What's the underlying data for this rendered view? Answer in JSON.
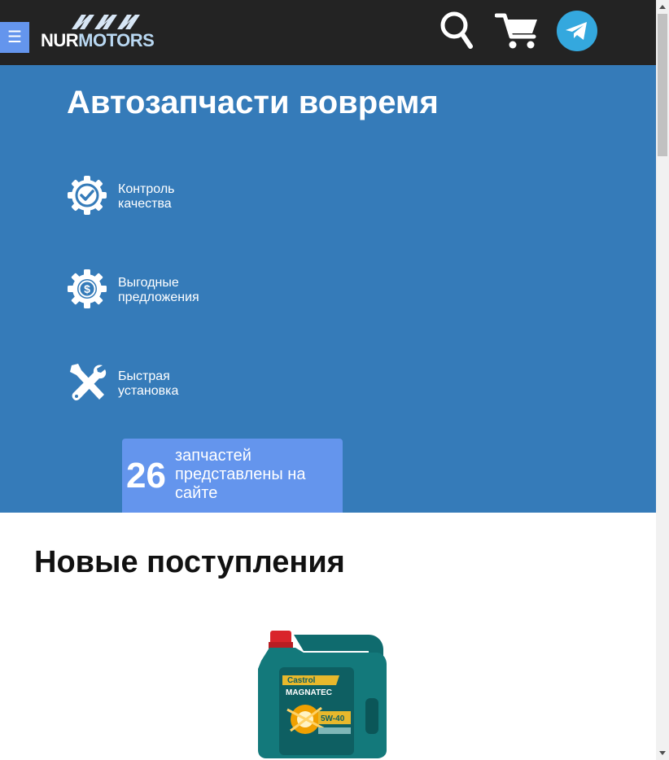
{
  "header": {
    "menu_label": "☰",
    "logo_nur": "NUR",
    "logo_motors": "MOTORS",
    "colors": {
      "background": "#232323",
      "menu": "#6495ed",
      "telegram": "#34a8de"
    },
    "icons": [
      "search-icon",
      "cart-icon",
      "telegram-icon"
    ]
  },
  "hero": {
    "title": "Автозапчасти вовремя",
    "background": "#357bb9",
    "features": [
      {
        "icon": "quality-check-icon",
        "line1": "Контроль",
        "line2": "качества"
      },
      {
        "icon": "dollar-gear-icon",
        "line1": "Выгодные",
        "line2": "предложения"
      },
      {
        "icon": "wrench-screwdriver-icon",
        "line1": "Быстрая",
        "line2": "установка"
      }
    ],
    "counter": {
      "number": "26",
      "text": "запчастей представлены на сайте",
      "background": "#6495ed"
    }
  },
  "new_arrivals": {
    "title": "Новые поступления",
    "product": {
      "brand": "Castrol",
      "name": "MAGNATEC",
      "viscosity": "5W-40"
    }
  }
}
